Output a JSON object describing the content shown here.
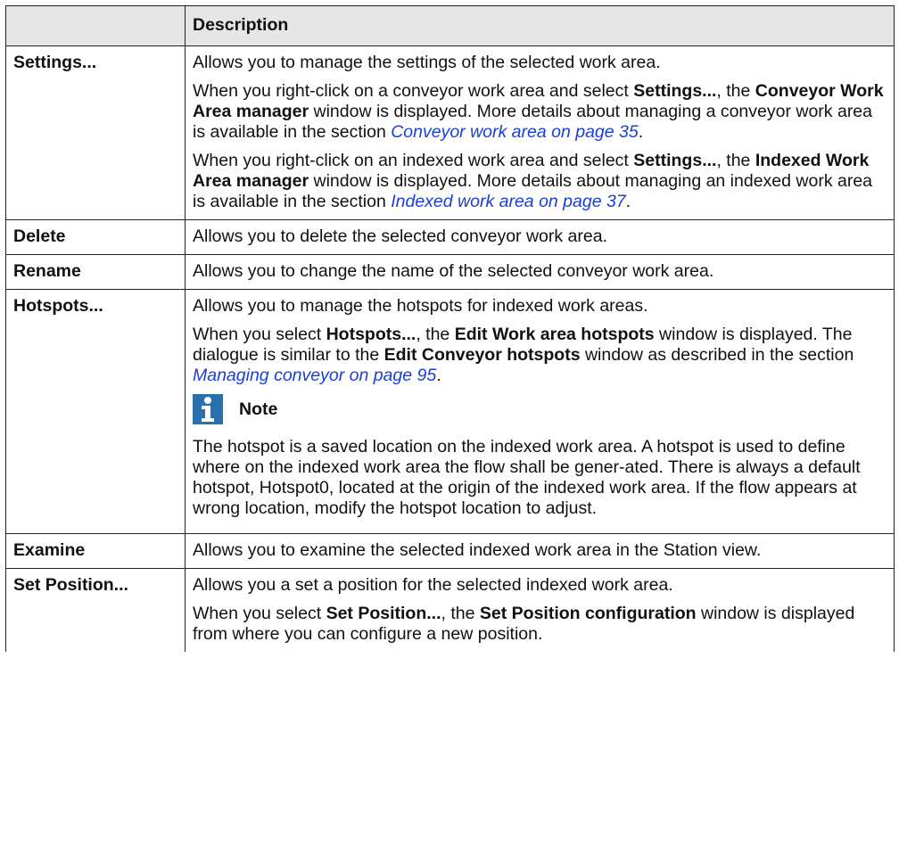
{
  "header": {
    "col1": "",
    "col2": "Description"
  },
  "rows": {
    "settings": {
      "menu": "Settings...",
      "p1": "Allows you to manage the settings of the selected work area.",
      "p2": {
        "pre": "When you right-click on a conveyor work area and select ",
        "b1": "Settings...",
        "mid1": ", the ",
        "b2": "Conveyor Work Area manager",
        "mid2": " window is displayed. More details about managing a conveyor work area is available in the section ",
        "link": "Conveyor work area on page 35",
        "post": "."
      },
      "p3": {
        "pre": "When you right-click on an indexed work area and select ",
        "b1": "Settings...",
        "mid1": ", the ",
        "b2": "Indexed Work Area manager",
        "mid2": " window is displayed. More details about managing an indexed work area is available in the section ",
        "link": "Indexed work area on page 37",
        "post": "."
      }
    },
    "delete": {
      "menu": "Delete",
      "desc": "Allows you to delete the selected conveyor work area."
    },
    "rename": {
      "menu": "Rename",
      "desc": "Allows you to change the name of the selected conveyor work area."
    },
    "hotspots": {
      "menu": "Hotspots...",
      "p1": "Allows you to manage the hotspots for indexed work areas.",
      "p2": {
        "pre": "When you select ",
        "b1": "Hotspots...",
        "mid1": ", the ",
        "b2": "Edit Work area hotspots",
        "mid2": " window is displayed. The dialogue is similar to the ",
        "b3": "Edit Conveyor hotspots",
        "mid3": " window as described in the section ",
        "link": "Managing conveyor on page 95",
        "post": "."
      },
      "note_label": "Note",
      "note_text": "The hotspot is a saved location on the indexed work area. A hotspot is used to define where on the indexed work area the flow shall be gener-ated. There is always a default hotspot, Hotspot0, located at the origin of the indexed work area. If the flow appears at wrong location, modify the hotspot location to adjust."
    },
    "examine": {
      "menu": "Examine",
      "desc": "Allows you to examine the selected indexed work area in the Station view."
    },
    "set_position": {
      "menu": "Set Position...",
      "p1": "Allows you a set a position for the selected indexed work area.",
      "p2": {
        "pre": "When you select ",
        "b1": "Set Position...",
        "mid1": ", the ",
        "b2": "Set Position configuration",
        "mid2": " window is displayed from where you can configure a new position."
      }
    }
  },
  "icons": {
    "note": "info-icon",
    "note_color": "#2a6fae",
    "link_color": "#1a3ed8"
  }
}
